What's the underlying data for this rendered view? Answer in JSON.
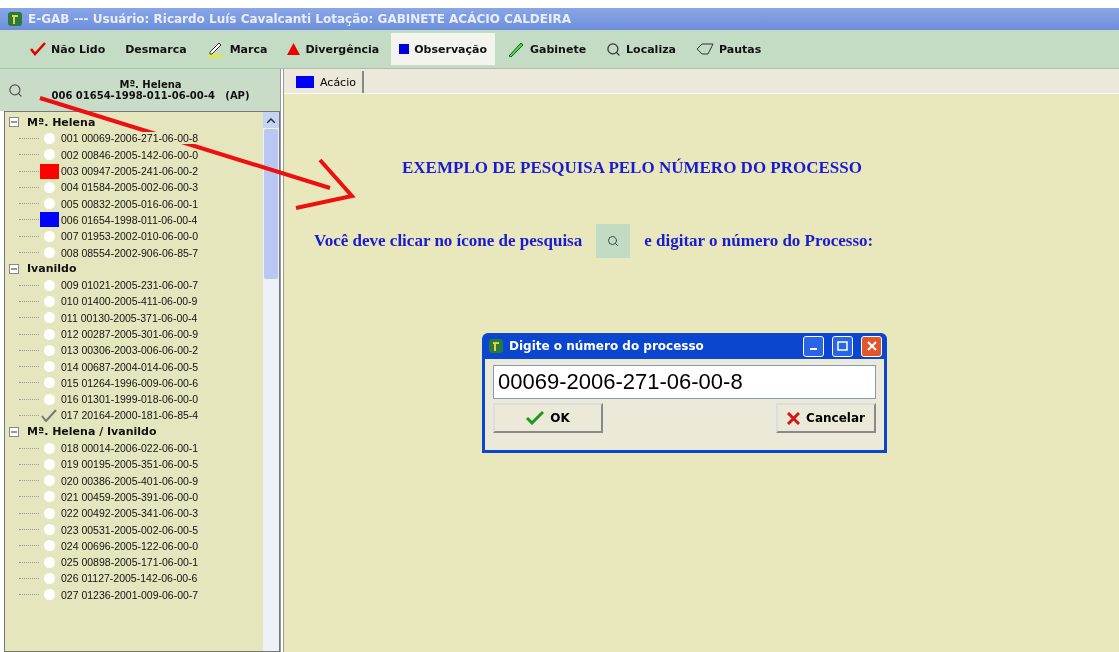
{
  "window": {
    "title": "E-GAB  ---  Usuário: Ricardo Luís Cavalcanti Lotação: GABINETE ACÁCIO CALDEIRA"
  },
  "toolbar": [
    {
      "label": "Não Lido",
      "selected": false
    },
    {
      "label": "Desmarca",
      "selected": false
    },
    {
      "label": "Marca",
      "selected": false
    },
    {
      "label": "Divergência",
      "selected": false
    },
    {
      "label": "Observação",
      "selected": true
    },
    {
      "label": "Gabinete",
      "selected": false
    },
    {
      "label": "Localiza",
      "selected": false
    },
    {
      "label": "Pautas",
      "selected": false
    }
  ],
  "search_panel": {
    "name": "Mª. Helena",
    "process": "006 01654-1998-011-06-00-4   (AP)"
  },
  "tree": [
    {
      "label": "Mª. Helena",
      "expanded": true,
      "children": [
        {
          "label": "001 00069-2006-271-06-00-8",
          "kind": "dot"
        },
        {
          "label": "002 00846-2005-142-06-00-0",
          "kind": "dot"
        },
        {
          "label": "003 00947-2005-241-06-00-2",
          "kind": "square",
          "color": "#ff0000"
        },
        {
          "label": "004 01584-2005-002-06-00-3",
          "kind": "dot"
        },
        {
          "label": "005 00832-2005-016-06-00-1",
          "kind": "dot"
        },
        {
          "label": "006 01654-1998-011-06-00-4",
          "kind": "square",
          "color": "#0000ff"
        },
        {
          "label": "007 01953-2002-010-06-00-0",
          "kind": "dot"
        },
        {
          "label": "008 08554-2002-906-06-85-7",
          "kind": "dot"
        }
      ]
    },
    {
      "label": "Ivanildo",
      "expanded": true,
      "children": [
        {
          "label": "009 01021-2005-231-06-00-7",
          "kind": "dot"
        },
        {
          "label": "010 01400-2005-411-06-00-9",
          "kind": "dot"
        },
        {
          "label": "011 00130-2005-371-06-00-4",
          "kind": "dot"
        },
        {
          "label": "012 00287-2005-301-06-00-9",
          "kind": "dot"
        },
        {
          "label": "013 00306-2003-006-06-00-2",
          "kind": "dot"
        },
        {
          "label": "014 00687-2004-014-06-00-5",
          "kind": "dot"
        },
        {
          "label": "015 01264-1996-009-06-00-6",
          "kind": "dot"
        },
        {
          "label": "016 01301-1999-018-06-00-0",
          "kind": "dot"
        },
        {
          "label": "017 20164-2000-181-06-85-4",
          "kind": "check"
        }
      ]
    },
    {
      "label": "Mª. Helena / Ivanildo",
      "expanded": true,
      "children": [
        {
          "label": "018 00014-2006-022-06-00-1",
          "kind": "dot"
        },
        {
          "label": "019 00195-2005-351-06-00-5",
          "kind": "dot"
        },
        {
          "label": "020 00386-2005-401-06-00-9",
          "kind": "dot"
        },
        {
          "label": "021 00459-2005-391-06-00-0",
          "kind": "dot"
        },
        {
          "label": "022 00492-2005-341-06-00-3",
          "kind": "dot"
        },
        {
          "label": "023 00531-2005-002-06-00-5",
          "kind": "dot"
        },
        {
          "label": "024 00696-2005-122-06-00-0",
          "kind": "dot"
        },
        {
          "label": "025 00898-2005-171-06-00-1",
          "kind": "dot"
        },
        {
          "label": "026 01127-2005-142-06-00-6",
          "kind": "dot"
        },
        {
          "label": "027 01236-2001-009-06-00-7",
          "kind": "dot"
        }
      ]
    }
  ],
  "tabs": [
    {
      "label": "Acácio",
      "color": "#0000ff",
      "selected": true
    }
  ],
  "content": {
    "heading": "EXEMPLO DE PESQUISA PELO NÚMERO DO PROCESSO",
    "instruction_before": "Você deve clicar no ícone de pesquisa",
    "instruction_after": "e digitar o número do Processo:"
  },
  "dialog": {
    "title": "Digite o número do processo",
    "value": "00069-2006-271-06-00-8",
    "buttons": [
      {
        "label": "OK",
        "kind": "ok"
      },
      {
        "label": "Cancelar",
        "kind": "cancel"
      }
    ]
  }
}
